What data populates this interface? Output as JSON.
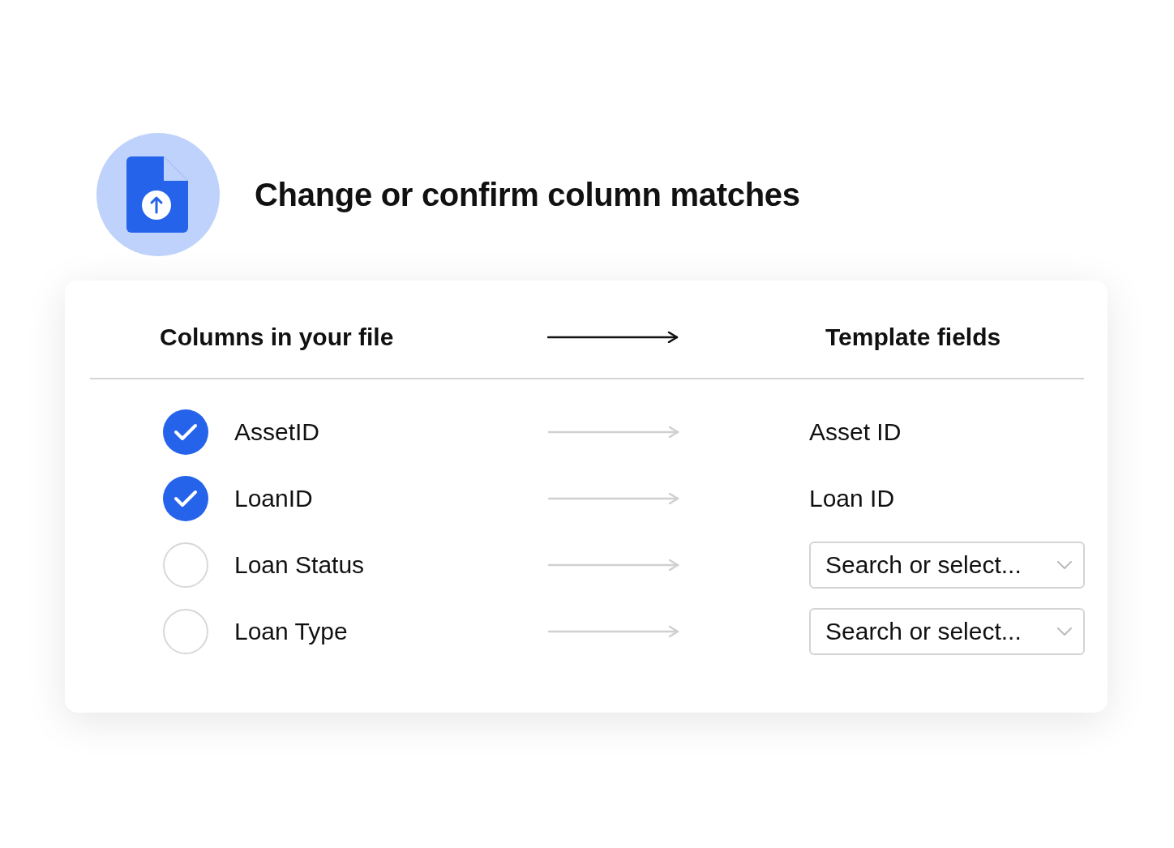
{
  "title": "Change or confirm column matches",
  "table": {
    "columns": [
      "Columns in your file",
      "Template fields"
    ],
    "rows": [
      {
        "name": "AssetID",
        "checked": true,
        "kind": "text",
        "field": {
          "value": "Asset ID"
        }
      },
      {
        "name": "LoanID",
        "checked": true,
        "kind": "text",
        "field": {
          "value": "Loan ID"
        }
      },
      {
        "name": "Loan Status",
        "checked": false,
        "kind": "select",
        "field": {
          "placeholder": "Search or select..."
        }
      },
      {
        "name": "Loan Type",
        "checked": false,
        "kind": "select",
        "field": {
          "placeholder": "Search or select..."
        }
      }
    ]
  }
}
